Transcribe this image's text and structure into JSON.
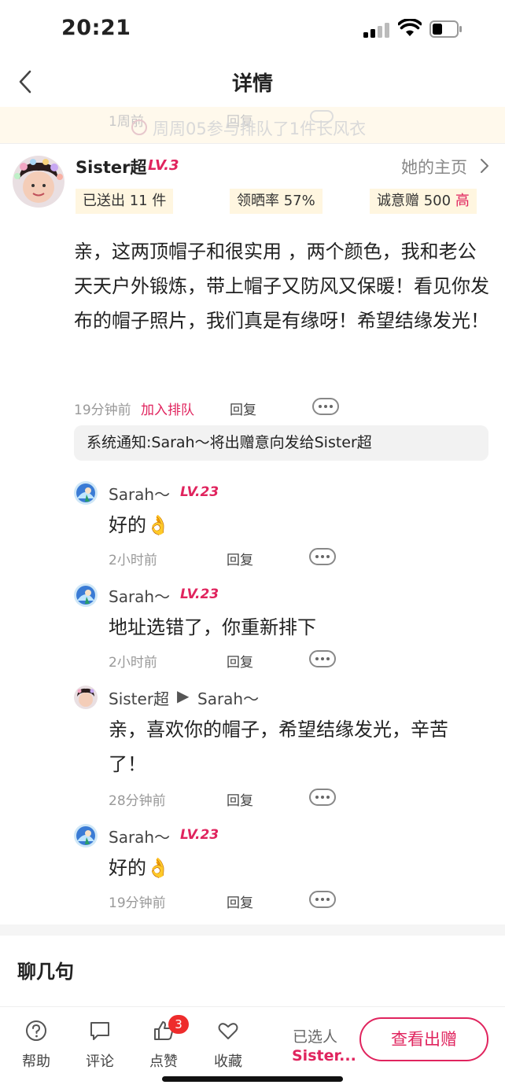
{
  "status_bar": {
    "time": "20:21"
  },
  "nav": {
    "title": "详情"
  },
  "peek": {
    "time": "1周前",
    "reply": "回复",
    "text": "周周05参与排队了1件长风衣"
  },
  "comment": {
    "user_name": "Sister超",
    "level": "LV.3",
    "homepage_link": "她的主页",
    "stats": {
      "sent": "已送出 11 件",
      "show_rate": "领晒率 57%",
      "sincerity_label": "诚意赠 500",
      "sincerity_level": "高"
    },
    "body": "亲，这两顶帽子和很实用 ，两个颜色，我和老公天天户外锻炼，带上帽子又防风又保暖！看见你发布的帽子照片，我们真是有缘呀！希望结缘发光！",
    "time": "19分钟前",
    "join_queue": "加入排队",
    "reply": "回复",
    "system_notice": "系统通知:Sarah～将出赠意向发给Sister超"
  },
  "replies": [
    {
      "name": "Sarah～",
      "level": "LV.23",
      "text": "好的👌",
      "time": "2小时前",
      "reply": "回复"
    },
    {
      "name": "Sarah～",
      "level": "LV.23",
      "text": "地址选错了，你重新排下",
      "time": "2小时前",
      "reply": "回复"
    },
    {
      "name": "Sister超",
      "arrow": "▶",
      "target": "Sarah～",
      "text": "亲，喜欢你的帽子，希望结缘发光，辛苦了！",
      "time": "28分钟前",
      "reply": "回复"
    },
    {
      "name": "Sarah～",
      "level": "LV.23",
      "text": "好的👌",
      "time": "19分钟前",
      "reply": "回复"
    }
  ],
  "chat_section": {
    "title": "聊几句"
  },
  "bottom_bar": {
    "help": "帮助",
    "comment": "评论",
    "like": "点赞",
    "like_badge": "3",
    "favorite": "收藏",
    "selected_label": "已选人",
    "selected_user": "Sister...",
    "view_button": "查看出赠"
  },
  "colors": {
    "accent": "#e0245e",
    "stat_bg": "#fff6e0",
    "notice_bg": "#f2f2f2"
  }
}
